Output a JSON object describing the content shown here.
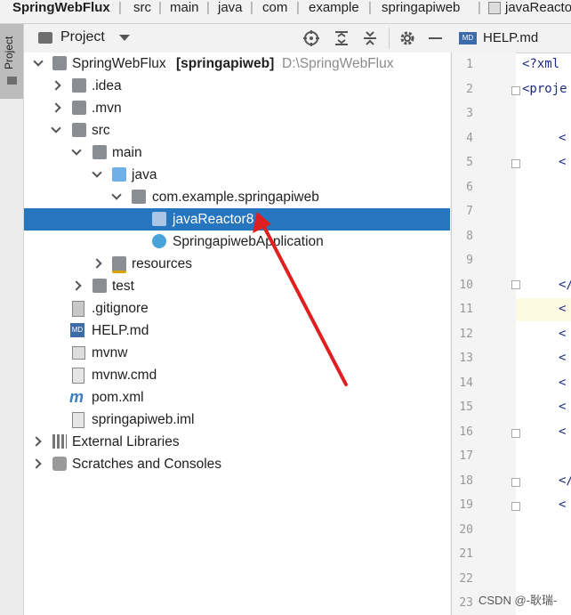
{
  "breadcrumb": [
    "SpringWebFlux",
    "src",
    "main",
    "java",
    "com",
    "example",
    "springapiweb",
    "javaReacto"
  ],
  "sidestrip": {
    "label": "Project"
  },
  "project_panel": {
    "title": "Project"
  },
  "tree": {
    "root": {
      "name": "SpringWebFlux",
      "module": "[springapiweb]",
      "path": "D:\\SpringWebFlux"
    },
    "idea": ".idea",
    "mvn": ".mvn",
    "src": "src",
    "main": "main",
    "java": "java",
    "package": "com.example.springapiweb",
    "selected": "javaReactor8",
    "app": "SpringapiwebApplication",
    "resources": "resources",
    "test": "test",
    "gitignore": ".gitignore",
    "help": "HELP.md",
    "mvnw": "mvnw",
    "mvnwcmd": "mvnw.cmd",
    "pom": "pom.xml",
    "iml": "springapiweb.iml",
    "extlib": "External Libraries",
    "scratches": "Scratches and Consoles"
  },
  "editor": {
    "tab": "HELP.md",
    "lines": [
      "1",
      "2",
      "3",
      "4",
      "5",
      "6",
      "7",
      "8",
      "9",
      "10",
      "11",
      "12",
      "13",
      "14",
      "15",
      "16",
      "17",
      "18",
      "19",
      "20",
      "21",
      "22",
      "23"
    ],
    "code": {
      "l1": "<?xml",
      "l2": "<proje",
      "l4": "<",
      "l5": "<",
      "l10": "</",
      "l11": "<",
      "l12": "<",
      "l13": "<",
      "l14": "<",
      "l15": "<",
      "l16": "<",
      "l18": "</",
      "l19": "<"
    }
  },
  "watermark": "CSDN @-耿瑞-",
  "colors": {
    "selection": "#2675bf",
    "annotation_arrow": "#e02020"
  }
}
